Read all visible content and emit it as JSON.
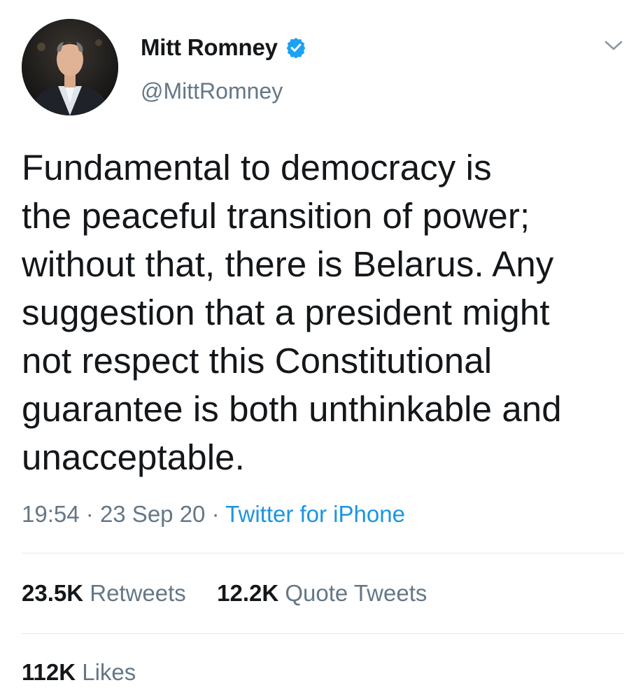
{
  "author": {
    "display_name": "Mitt Romney",
    "handle": "@MittRomney",
    "verified": true,
    "avatar_icon": "profile-photo"
  },
  "tweet": {
    "lines": [
      "Fundamental to democracy is",
      "the peaceful transition of power;",
      "without that, there is Belarus. Any",
      "suggestion that a president might",
      "not respect this Constitutional",
      "guarantee is both unthinkable and",
      "unacceptable."
    ],
    "time": "19:54",
    "separator": "·",
    "date": "23 Sep 20",
    "source": "Twitter for iPhone"
  },
  "stats": {
    "retweets_count": "23.5K",
    "retweets_label": "Retweets",
    "quotes_count": "12.2K",
    "quotes_label": "Quote Tweets",
    "likes_count": "112K",
    "likes_label": "Likes"
  },
  "colors": {
    "verified_badge": "#1da1f2",
    "secondary_text": "#657786",
    "link": "#1b95e0",
    "divider": "#e1e8ed"
  },
  "icons": {
    "verified": "verified-badge-icon",
    "menu": "chevron-down-icon"
  }
}
